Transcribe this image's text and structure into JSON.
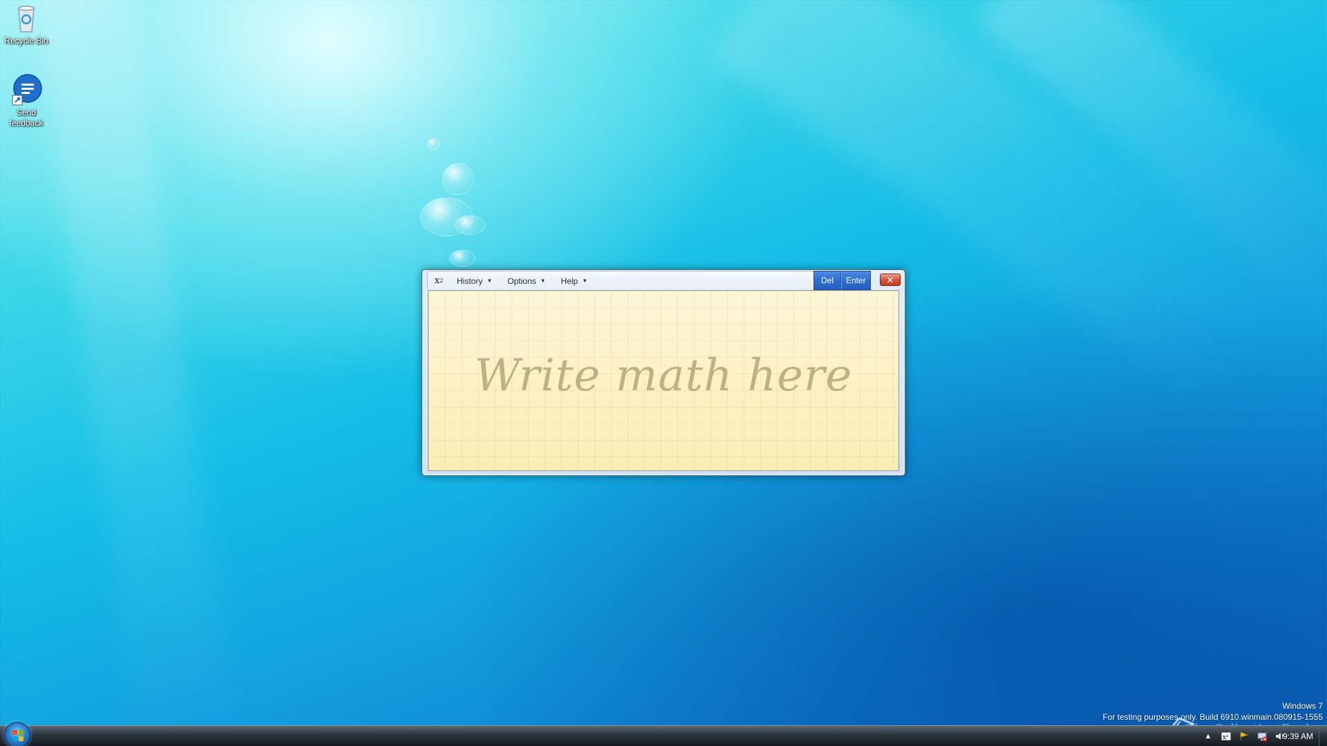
{
  "desktop": {
    "icons": [
      {
        "label": "Recycle Bin",
        "icon": "recycle-bin-icon"
      },
      {
        "label": "Send feedback",
        "icon": "send-feedback-icon"
      }
    ]
  },
  "math_panel": {
    "app_icon_text": "x",
    "app_icon_sup": "2",
    "menus": [
      {
        "label": "History"
      },
      {
        "label": "Options"
      },
      {
        "label": "Help"
      }
    ],
    "del_label": "Del",
    "enter_label": "Enter",
    "placeholder": "Write math here"
  },
  "watermark": {
    "line1": "Windows 7",
    "line2": "For testing purposes only. Build 6910.winmain.080915-1555",
    "collection": "The Collection Book"
  },
  "taskbar": {
    "clock": "9:39 AM",
    "tray_icons": [
      "show-hidden-icons-arrow",
      "math-input-icon",
      "action-center-icon",
      "network-icon",
      "volume-icon"
    ]
  },
  "colors": {
    "accent_button": "#2f6fcf",
    "close_button": "#d4563b",
    "writing_area": "#fdf2c2"
  }
}
